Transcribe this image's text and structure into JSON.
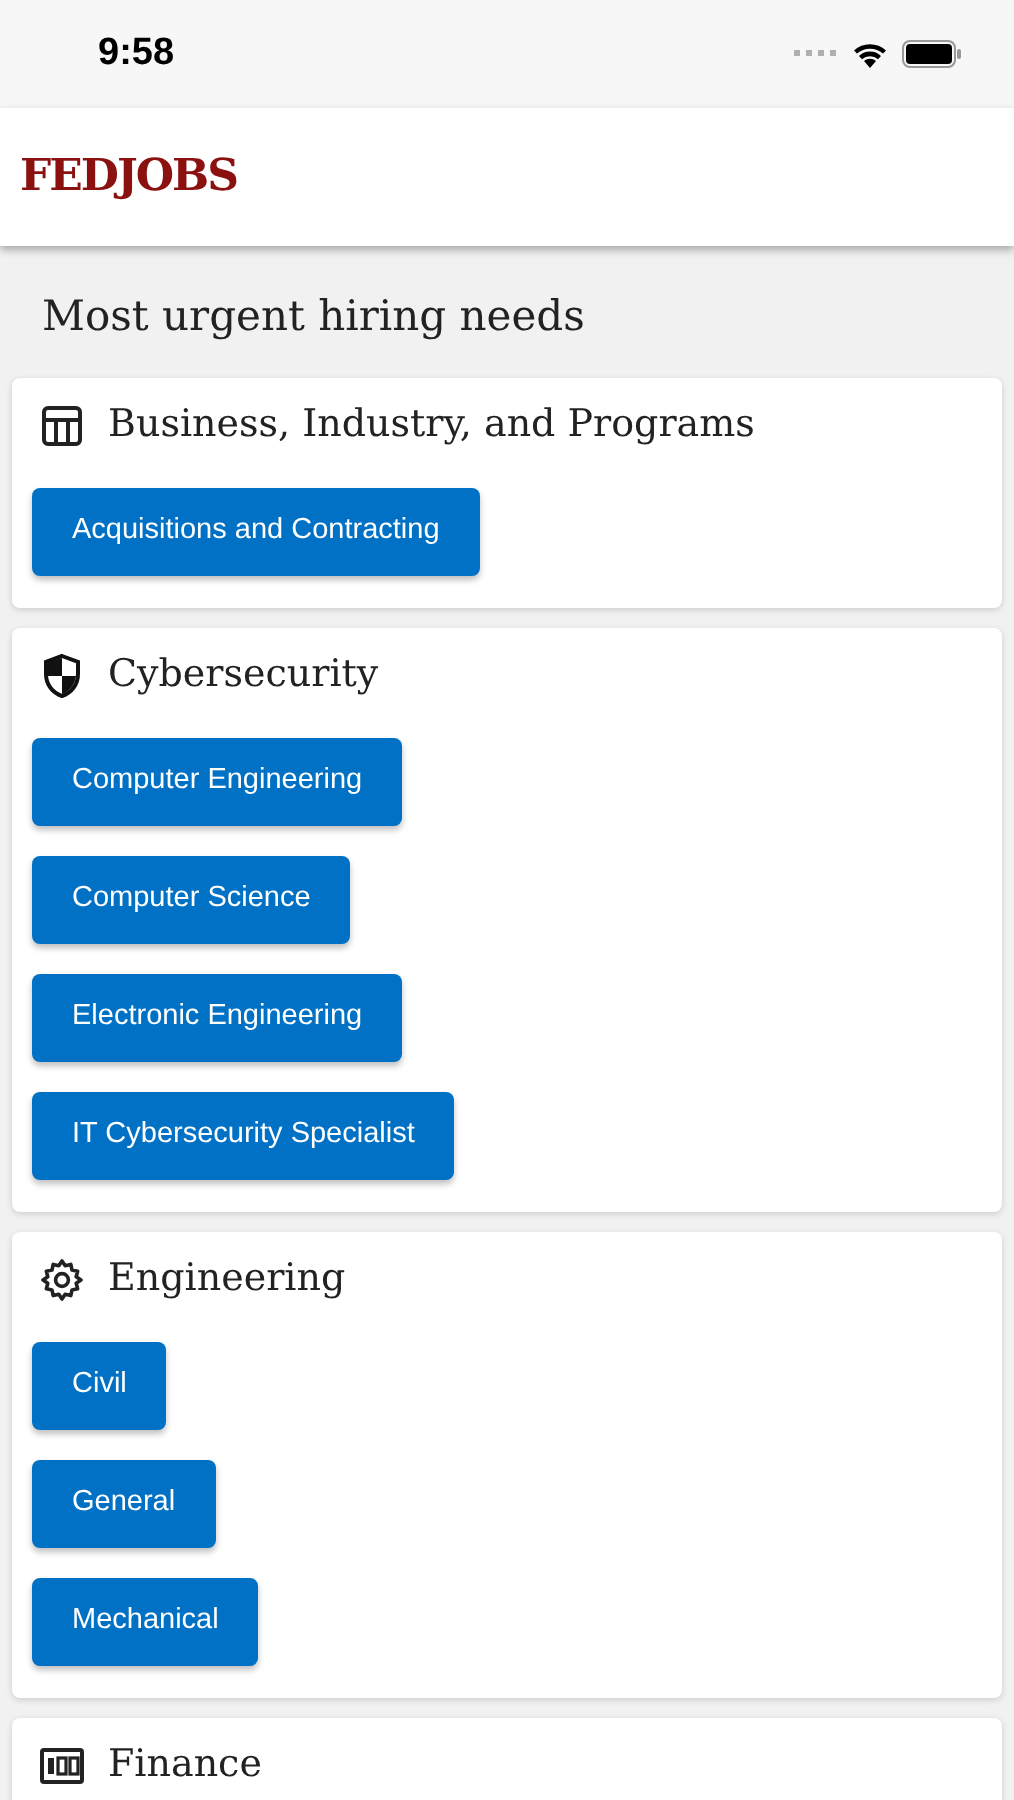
{
  "status_bar": {
    "time": "9:58"
  },
  "header": {
    "logo": "FEDJOBS"
  },
  "page_title": "Most urgent hiring needs",
  "categories": [
    {
      "title": "Business, Industry, and Programs",
      "jobs": [
        "Acquisitions and Contracting"
      ]
    },
    {
      "title": "Cybersecurity",
      "jobs": [
        "Computer Engineering",
        "Computer Science",
        "Electronic Engineering",
        "IT Cybersecurity Specialist"
      ]
    },
    {
      "title": "Engineering",
      "jobs": [
        "Civil",
        "General",
        "Mechanical"
      ]
    },
    {
      "title": "Finance"
    }
  ]
}
